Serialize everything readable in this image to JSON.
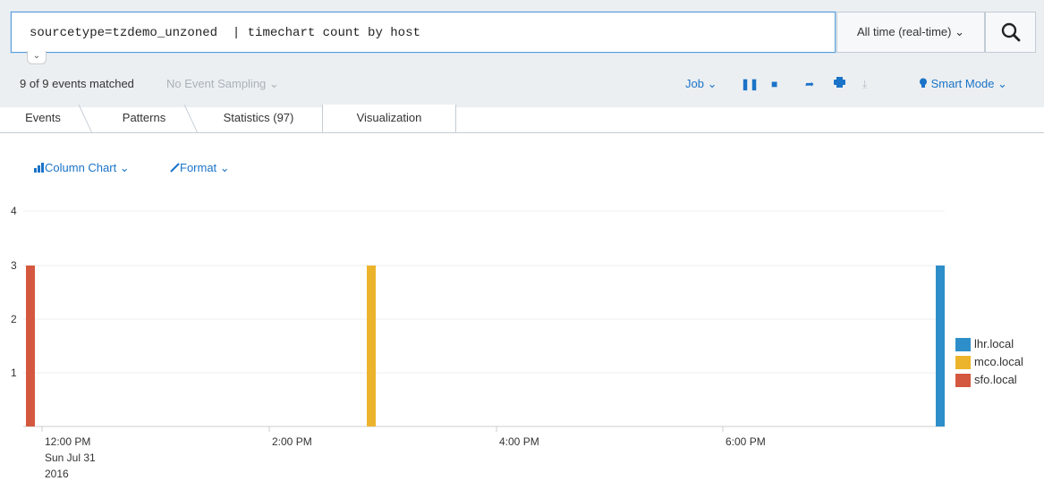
{
  "search": {
    "query": "sourcetype=tzdemo_unzoned  | timechart count by host",
    "expand_caret": "⌄",
    "time_range": "All time (real-time)",
    "time_caret": "⌄"
  },
  "status": {
    "matched": "9 of 9 events matched",
    "sampling": "No Event Sampling ⌄",
    "job": "Job ⌄",
    "smart_mode": "Smart Mode ⌄"
  },
  "tabs": [
    {
      "label": "Events"
    },
    {
      "label": "Patterns"
    },
    {
      "label": "Statistics (97)"
    },
    {
      "label": "Visualization"
    }
  ],
  "viz": {
    "chart_type": "Column Chart ⌄",
    "format": "Format ⌄"
  },
  "colors": {
    "lhr": "#2e8ec9",
    "mco": "#ecb42c",
    "sfo": "#d4583f",
    "link": "#1a73c8"
  },
  "chart_data": {
    "type": "bar",
    "y_ticks": [
      "1",
      "2",
      "3",
      "4"
    ],
    "ylim": [
      0,
      4
    ],
    "x_tick_labels": [
      "12:00 PM",
      "2:00 PM",
      "4:00 PM",
      "6:00 PM"
    ],
    "x_date_label_line2": "Sun Jul 31",
    "x_date_label_line3": "2016",
    "series": [
      {
        "name": "lhr.local",
        "x": "~7:40 PM",
        "values": [
          3
        ]
      },
      {
        "name": "mco.local",
        "x": "~2:50 PM",
        "values": [
          3
        ]
      },
      {
        "name": "sfo.local",
        "x": "~11:50 AM",
        "values": [
          3
        ]
      }
    ],
    "legend_position": "right"
  }
}
